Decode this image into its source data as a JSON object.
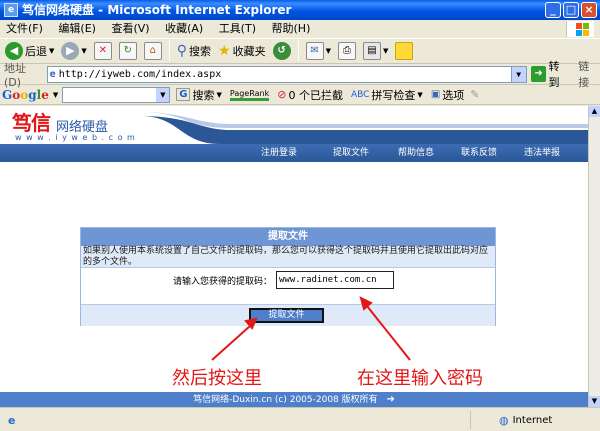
{
  "window": {
    "title": "笃信网络硬盘 - Microsoft Internet Explorer",
    "controls": [
      "_",
      "□",
      "×"
    ]
  },
  "menu": [
    "文件(F)",
    "编辑(E)",
    "查看(V)",
    "收藏(A)",
    "工具(T)",
    "帮助(H)"
  ],
  "toolbar": {
    "back": "后退",
    "search": "搜索",
    "favorites": "收藏夹"
  },
  "address": {
    "label": "地址(D)",
    "url": "http://iyweb.com/index.aspx",
    "go": "转到",
    "links": "链接"
  },
  "google_bar": {
    "logo": "Google",
    "search": "搜索",
    "pagerank": "PageRank",
    "blocked": "0 个已拦截",
    "spellcheck": "拼写检查",
    "options": "选项"
  },
  "site": {
    "logo_main": "笃信",
    "logo_sub": "网络硬盘",
    "logo_url": "w w w . i y w e b . c o m",
    "nav": [
      "注册登录",
      "提取文件",
      "帮助信息",
      "联系反馈",
      "违法举报"
    ],
    "panel": {
      "title": "提取文件",
      "description": "如果别人使用本系统设置了自己文件的提取码，那么您可以获得这个提取码并且使用它提取出此码对应的多个文件。",
      "field_label": "请输入您获得的提取码：",
      "field_value": "www.radinet.com.cn",
      "button": "提取文件"
    },
    "footer": "笃信网络-Duxin.cn (c) 2005-2008 版权所有"
  },
  "annotations": {
    "left": "然后按这里",
    "right": "在这里输入密码",
    "color": "#e21717"
  },
  "status": {
    "zone": "Internet"
  },
  "colors": {
    "accent": "#4f7fcb",
    "title_bar": "#0055e5",
    "logo_red": "#e0161a"
  }
}
